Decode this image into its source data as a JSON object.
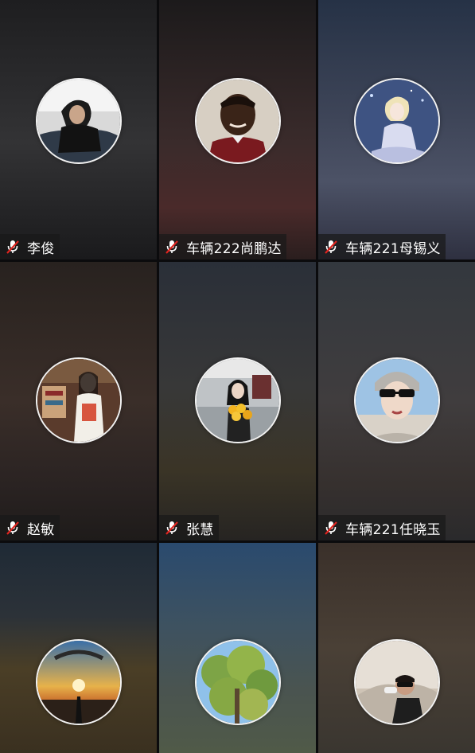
{
  "participants": [
    {
      "name": "李俊",
      "muted": true,
      "avatar": "person-hand-on-face-photo",
      "bg": [
        "#1e1e20",
        "#3a3a3d",
        "#1a1a1c"
      ]
    },
    {
      "name": "车辆222尚鹏达",
      "muted": true,
      "avatar": "smiling-boy-portrait-photo",
      "bg": [
        "#201c1c",
        "#4a2c2c",
        "#2a1e1e"
      ]
    },
    {
      "name": "车辆221母锡义",
      "muted": true,
      "avatar": "anime-character-illustration",
      "bg": [
        "#2a3446",
        "#4e5466",
        "#2e3040"
      ]
    },
    {
      "name": "赵敏",
      "muted": true,
      "avatar": "woman-in-shop-photo",
      "bg": [
        "#2a2420",
        "#3b2f2a",
        "#1e1b1a"
      ]
    },
    {
      "name": "张慧",
      "muted": true,
      "avatar": "woman-with-flowers-photo",
      "bg": [
        "#2b3038",
        "#3a3838",
        "#282626"
      ]
    },
    {
      "name": "车辆221任晓玉",
      "muted": true,
      "avatar": "woman-with-sunglasses-photo",
      "bg": [
        "#3a3838",
        "#403e40",
        "#2a2a2c"
      ]
    },
    {
      "name": "",
      "muted": false,
      "avatar": "sunset-paraglider-photo",
      "bg": [
        "#24303c",
        "#5a4a30",
        "#3a3020"
      ]
    },
    {
      "name": "",
      "muted": false,
      "avatar": "green-tree-sky-photo",
      "bg": [
        "#2c4a6a",
        "#465a5a",
        "#505a48"
      ]
    },
    {
      "name": "",
      "muted": false,
      "avatar": "man-drinking-photo",
      "bg": [
        "#3a302a",
        "#4a4036",
        "#3a3630"
      ]
    }
  ]
}
